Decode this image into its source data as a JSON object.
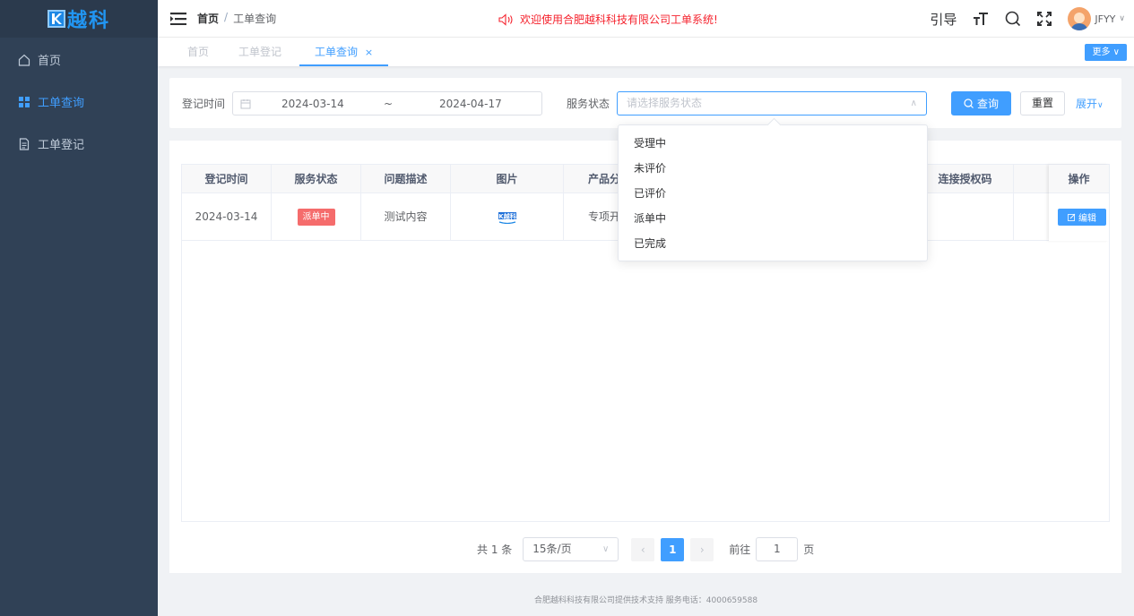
{
  "logo": {
    "text": "越科"
  },
  "sidebar": {
    "items": [
      {
        "label": "首页",
        "icon": "home-icon",
        "active": false
      },
      {
        "label": "工单查询",
        "icon": "grid-icon",
        "active": true
      },
      {
        "label": "工单登记",
        "icon": "document-icon",
        "active": false
      }
    ]
  },
  "header": {
    "breadcrumb": [
      "首页",
      "/",
      "工单查询"
    ],
    "announcement": "欢迎使用合肥越科科技有限公司工单系统!",
    "guide": "引导",
    "username": "JFYY"
  },
  "tags": {
    "items": [
      "首页",
      "工单登记",
      "工单查询"
    ],
    "active_close": "×",
    "more": "更多"
  },
  "search": {
    "date_label": "登记时间",
    "date_start": "2024-03-14",
    "date_sep": "~",
    "date_end": "2024-04-17",
    "status_label": "服务状态",
    "status_placeholder": "请选择服务状态",
    "query_button": "查询",
    "reset_button": "重置",
    "expand": "展开"
  },
  "table": {
    "columns": [
      "登记时间",
      "服务状态",
      "问题描述",
      "图片",
      "产品分",
      "连接授权码",
      "",
      "操作"
    ],
    "rows": [
      {
        "time": "2024-03-14",
        "status": "派单中",
        "desc": "测试内容",
        "product": "专项开",
        "edit": "编辑"
      }
    ]
  },
  "dropdown": {
    "options": [
      "受理中",
      "未评价",
      "已评价",
      "派单中",
      "已完成"
    ]
  },
  "pager": {
    "total": "共 1 条",
    "page_size": "15条/页",
    "current": "1",
    "goto_label": "前往",
    "goto_value": "1",
    "page_unit": "页"
  },
  "footer": {
    "text": "合肥越科科技有限公司提供技术支持 服务电话：4000659588"
  },
  "colors": {
    "primary": "#409eff",
    "sidebar": "#304156",
    "danger": "#f56c6c",
    "announce": "#f5222d"
  }
}
